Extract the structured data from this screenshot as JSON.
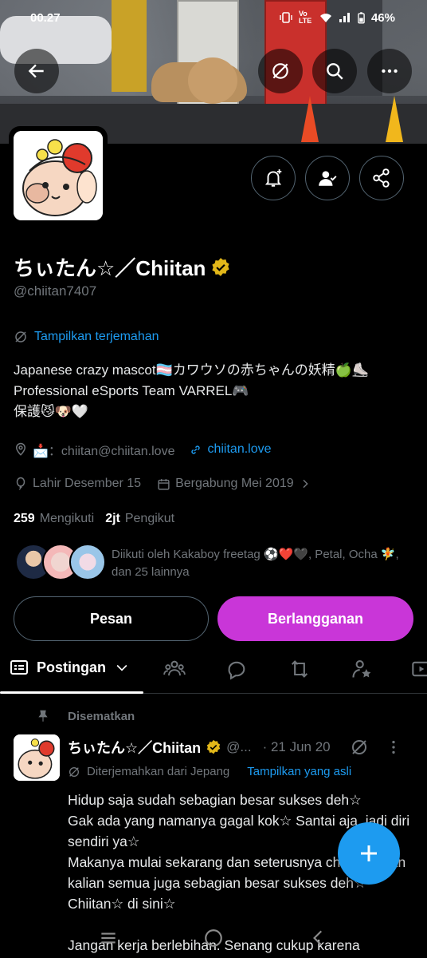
{
  "status_bar": {
    "time": "00.27",
    "battery": "46%",
    "network": "Vo LTE"
  },
  "header": {
    "back_icon": "arrow-left-icon",
    "translate_icon": "translate-off-icon",
    "search_icon": "search-icon",
    "more_icon": "more-horizontal-icon"
  },
  "profile": {
    "display_name": "ちぃたん☆／Chiitan",
    "handle": "@chiitan7407",
    "verified_color": "#e2b719",
    "translate_label": "Tampilkan terjemahan",
    "bio_line1": "Japanese crazy mascot🏳️‍⚧️カワウソの赤ちゃんの妖精🍏⛸️",
    "bio_line2": "Professional eSports Team VARREL🎮",
    "bio_line3": "保護😼🐶🤍",
    "contact": "📩：chiitan@chiitan.love",
    "website": "chiitan.love",
    "birthday": "Lahir Desember 15",
    "joined": "Bergabung Mei 2019",
    "following_count": "259",
    "following_label": "Mengikuti",
    "followers_count": "2jt",
    "followers_label": "Pengikut",
    "followed_by": "Diikuti oleh Kakaboy freetag ⚽❤️🖤, Petal, Ocha 🧚, dan 25 lainnya"
  },
  "actions": {
    "message_label": "Pesan",
    "subscribe_label": "Berlangganan",
    "subscribe_color": "#c936d8"
  },
  "tabs": {
    "active_label": "Postingan"
  },
  "post": {
    "pinned_label": "Disematkan",
    "author": "ちぃたん☆／Chiitan",
    "handle_short": "@...",
    "date": "· 21 Jun 20",
    "translated_from": "Diterjemahkan dari Jepang",
    "show_original": "Tampilkan yang asli",
    "text": "Hidup saja sudah sebagian besar sukses deh☆\nGak ada yang namanya gagal kok☆ Santai aja, jadi diri sendiri ya☆\nMakanya mulai sekarang dan seterusnya chiitan☆ dan kalian semua juga sebagian besar sukses deh☆ Chiitan☆ di sini☆\n\nJangan kerja berlebihan. Senang cukup karena"
  },
  "colors": {
    "accent": "#1d9bf0",
    "muted": "#71767b",
    "border": "#536471"
  }
}
